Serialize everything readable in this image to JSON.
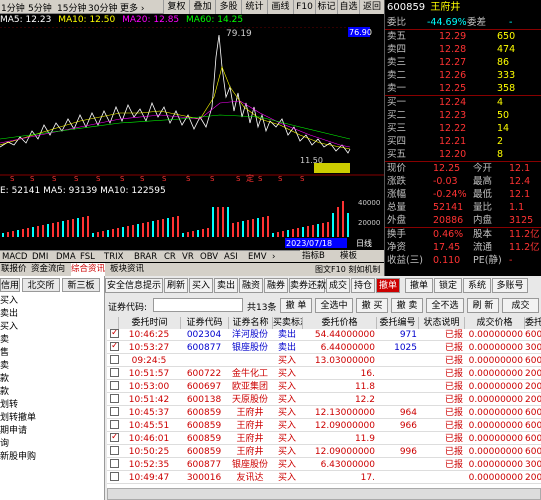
{
  "toolbar": {
    "periods": [
      "1分钟",
      "5分钟",
      "15分钟",
      "30分钟",
      "更多 ›"
    ],
    "buttons": [
      "复权",
      "叠加",
      "多股",
      "统计",
      "画线",
      "F10",
      "标记",
      "自选",
      "返回"
    ]
  },
  "ma_legend": {
    "ma5": "MA5: 12.23",
    "ma10": "MA10: 12.50",
    "ma20": "MA20: 12.85",
    "ma60": "MA60: 14.25"
  },
  "price_chart": {
    "high_label": "79.19",
    "low_label": "11.50",
    "top_price": "76.90",
    "right_marker": "定",
    "vol_legend": "E: 52141  MA5: 93139  MA10: 122595",
    "date_label": "2023/07/18",
    "pane_label": "日线",
    "vol_axis": [
      "40000",
      "20000"
    ],
    "buttons": [
      "指标B",
      "模板"
    ]
  },
  "chart_data": {
    "type": "line",
    "title": "",
    "series": [
      {
        "values": []
      }
    ],
    "peak": 79.19,
    "trough": 11.5,
    "last_top_price": 76.9
  },
  "quote": {
    "code": "600859",
    "name": "王府井",
    "ratio_label": "委比",
    "ratio_value": "-44.69%",
    "diff_label": "委差",
    "diff_value": "-",
    "asks": [
      {
        "label": "卖五",
        "price": "12.29",
        "vol": "650"
      },
      {
        "label": "卖四",
        "price": "12.28",
        "vol": "474"
      },
      {
        "label": "卖三",
        "price": "12.27",
        "vol": "86"
      },
      {
        "label": "卖二",
        "price": "12.26",
        "vol": "333"
      },
      {
        "label": "卖一",
        "price": "12.25",
        "vol": "358"
      }
    ],
    "bids": [
      {
        "label": "买一",
        "price": "12.24",
        "vol": "4"
      },
      {
        "label": "买二",
        "price": "12.23",
        "vol": "50"
      },
      {
        "label": "买三",
        "price": "12.22",
        "vol": "14"
      },
      {
        "label": "买四",
        "price": "12.21",
        "vol": "2"
      },
      {
        "label": "买五",
        "price": "12.20",
        "vol": "8"
      }
    ],
    "stats": [
      {
        "l1": "现价",
        "v1": "12.25",
        "l2": "今开",
        "v2": "12.1"
      },
      {
        "l1": "涨跌",
        "v1": "-0.03",
        "l2": "最高",
        "v2": "12.4"
      },
      {
        "l1": "涨幅",
        "v1": "-0.24%",
        "l2": "最低",
        "v2": "12.1"
      },
      {
        "l1": "总量",
        "v1": "52141",
        "l2": "量比",
        "v2": "1.1"
      },
      {
        "l1": "外盘",
        "v1": "20886",
        "l2": "内盘",
        "v2": "3125"
      }
    ],
    "stats2": [
      {
        "l1": "换手",
        "v1": "0.46%",
        "l2": "股本",
        "v2": "11.2亿"
      },
      {
        "l1": "净资",
        "v1": "17.45",
        "l2": "流通",
        "v2": "11.2亿"
      },
      {
        "l1": "收益(三)",
        "v1": "0.110",
        "l2": "PE(静)",
        "v2": "-"
      }
    ]
  },
  "indicators": [
    "MACD",
    "DMI",
    "DMA",
    "FSL",
    "TRIX",
    "BRAR",
    "CR",
    "VR",
    "OBV",
    "ASI",
    "EMV",
    "›"
  ],
  "navbar": [
    "联报价",
    "资金流向",
    "综合资讯",
    "板块资讯"
  ],
  "navbar_right": "图文F10 刻如机制",
  "left_panel": {
    "tabs": [
      "信用",
      "北交所",
      "新三板"
    ],
    "items": [
      "买入",
      "卖出",
      "买入",
      "卖",
      "售",
      "卖",
      "款",
      "款",
      "划转",
      "划转撤单",
      "期申请",
      "询",
      "新股申购"
    ]
  },
  "order_toolbar": {
    "buttons": [
      "安全信息提示",
      "刷新",
      "买入",
      "卖出",
      "融资",
      "融券",
      "卖券还款",
      "成交",
      "持仓",
      "撤单",
      "撤单",
      "锁定",
      "系统",
      "多账号"
    ],
    "active": "撤单"
  },
  "filter_bar": {
    "code_label": "证券代码:",
    "count": "共13条",
    "buy_btn": "撤 单",
    "select_all": "全选中",
    "sell_btn": "撤 买",
    "sell_btn2": "撤 卖",
    "none_btn": "全不选",
    "refresh": "刷 新",
    "other": "成交"
  },
  "order_table": {
    "headers": [
      "委托时间",
      "证券代码",
      "证券名称",
      "买卖标志",
      "委托价格",
      "委托编号",
      "状态说明",
      "成交价格",
      "委托数量"
    ],
    "rows": [
      {
        "checked": true,
        "time": "10:46:25",
        "code": "002304",
        "name": "洋河股份",
        "side": "卖出",
        "price": "54.44000000",
        "no": "971",
        "status": "已报",
        "deal": "0.00000000",
        "qty": "600.000"
      },
      {
        "checked": true,
        "time": "10:53:27",
        "code": "600877",
        "name": "银座股份",
        "side": "卖出",
        "price": "6.44000000",
        "no": "1025",
        "status": "已报",
        "deal": "0.00000000",
        "qty": "30000.000"
      },
      {
        "checked": false,
        "time": "09:24:5",
        "code": "",
        "name": "",
        "side": "买入",
        "price": "13.03000000",
        "no": "",
        "status": "已报",
        "deal": "0.00000000",
        "qty": "600.000"
      },
      {
        "checked": false,
        "time": "10:51:57",
        "code": "600722",
        "name": "金牛化工",
        "side": "买入",
        "price": "16.",
        "no": "",
        "status": "已报",
        "deal": "0.00000000",
        "qty": "200.000"
      },
      {
        "checked": false,
        "time": "10:53:00",
        "code": "600697",
        "name": "欧亚集团",
        "side": "买入",
        "price": "11.8",
        "no": "",
        "status": "已报",
        "deal": "0.00000000",
        "qty": "200.000"
      },
      {
        "checked": false,
        "time": "10:51:42",
        "code": "600138",
        "name": "天原股份",
        "side": "买入",
        "price": "12.2",
        "no": "",
        "status": "已报",
        "deal": "0.00000000",
        "qty": "200.000"
      },
      {
        "checked": false,
        "time": "10:45:37",
        "code": "600859",
        "name": "王府井",
        "side": "买入",
        "price": "12.13000000",
        "no": "964",
        "status": "已报",
        "deal": "0.00000000",
        "qty": "600.000"
      },
      {
        "checked": false,
        "time": "10:45:51",
        "code": "600859",
        "name": "王府井",
        "side": "买入",
        "price": "12.09000000",
        "no": "966",
        "status": "已报",
        "deal": "0.00000000",
        "qty": "600.000"
      },
      {
        "checked": true,
        "time": "10:46:01",
        "code": "600859",
        "name": "王府井",
        "side": "买入",
        "price": "11.9",
        "no": "",
        "status": "已报",
        "deal": "0.00000000",
        "qty": "600.000"
      },
      {
        "checked": false,
        "time": "10:50:25",
        "code": "600859",
        "name": "王府井",
        "side": "买入",
        "price": "12.09000000",
        "no": "996",
        "status": "已报",
        "deal": "0.00000000",
        "qty": "600.000"
      },
      {
        "checked": false,
        "time": "10:52:35",
        "code": "600877",
        "name": "银座股份",
        "side": "买入",
        "price": "6.43000000",
        "no": "",
        "status": "已报",
        "deal": "0.00000000",
        "qty": "300.000"
      },
      {
        "checked": false,
        "time": "10:49:47",
        "code": "300016",
        "name": "友讯达",
        "side": "买入",
        "price": "17.",
        "no": "",
        "status": "",
        "deal": "0.00000000",
        "qty": "200.000"
      }
    ]
  },
  "colors": {
    "up": "#ff3333",
    "down": "#00ffff",
    "label": "#c0c0c0",
    "yellow": "#ffff00"
  }
}
